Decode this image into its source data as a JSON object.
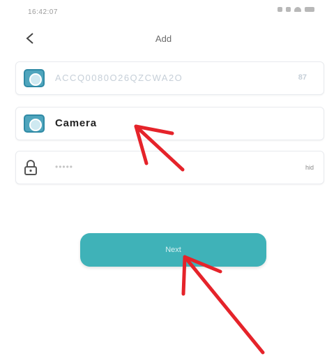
{
  "status_bar": {
    "time": "16:42:07"
  },
  "nav": {
    "back_label": "<",
    "title": "Add"
  },
  "fields": {
    "uid": {
      "value": "ACCQ0080O26QZCWA2O",
      "suffix": "87"
    },
    "name": {
      "value": "Camera"
    },
    "password": {
      "value": "•••••",
      "suffix": "hid"
    }
  },
  "next_button": {
    "label": "Next"
  },
  "colors": {
    "accent": "#3fb2b8",
    "annotation": "#e5232a",
    "icon_blue": "#4fa5bd"
  },
  "icons": [
    "back-chevron-icon",
    "camera-icon",
    "lock-icon",
    "signal-icon",
    "wifi-icon",
    "battery-icon"
  ]
}
